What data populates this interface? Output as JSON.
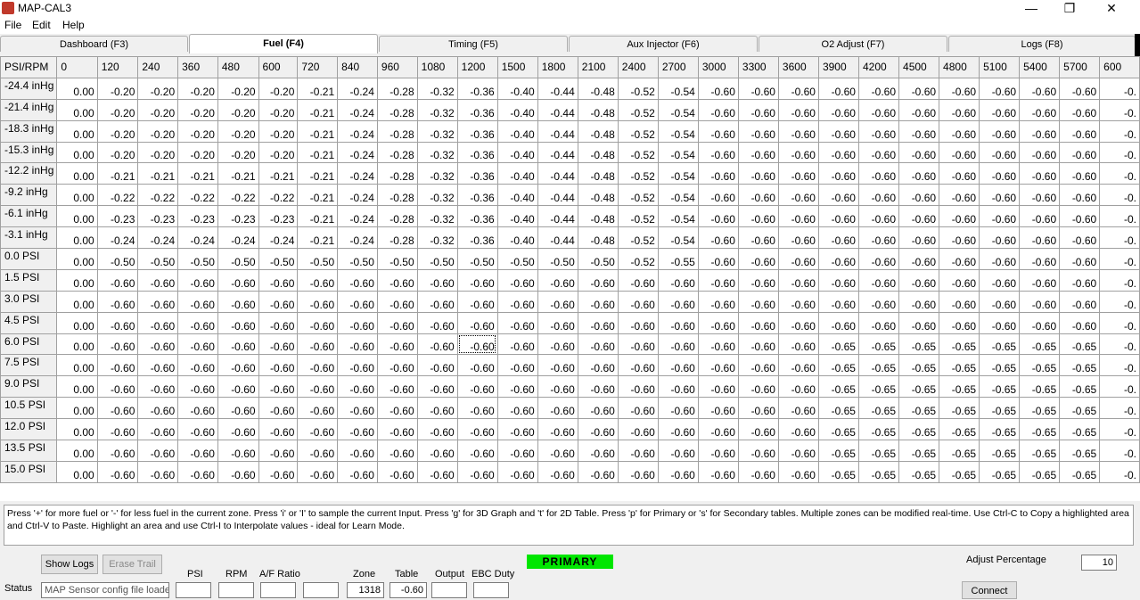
{
  "window": {
    "title": "MAP-CAL3",
    "minimize": "—",
    "restore": "❐",
    "close": "✕"
  },
  "menu": [
    "File",
    "Edit",
    "Help"
  ],
  "tabs": [
    {
      "label": "Dashboard (F3)",
      "active": false
    },
    {
      "label": "Fuel (F4)",
      "active": true
    },
    {
      "label": "Timing (F5)",
      "active": false
    },
    {
      "label": "Aux Injector (F6)",
      "active": false
    },
    {
      "label": "O2 Adjust (F7)",
      "active": false
    },
    {
      "label": "Logs (F8)",
      "active": false
    }
  ],
  "grid": {
    "corner": "PSI/RPM",
    "columns": [
      "0",
      "120",
      "240",
      "360",
      "480",
      "600",
      "720",
      "840",
      "960",
      "1080",
      "1200",
      "1500",
      "1800",
      "2100",
      "2400",
      "2700",
      "3000",
      "3300",
      "3600",
      "3900",
      "4200",
      "4500",
      "4800",
      "5100",
      "5400",
      "5700",
      "600"
    ],
    "selected": {
      "row": 12,
      "col": 10
    },
    "rows": [
      {
        "label": "-24.4 inHg",
        "values": [
          "0.00",
          "-0.20",
          "-0.20",
          "-0.20",
          "-0.20",
          "-0.20",
          "-0.21",
          "-0.24",
          "-0.28",
          "-0.32",
          "-0.36",
          "-0.40",
          "-0.44",
          "-0.48",
          "-0.52",
          "-0.54",
          "-0.60",
          "-0.60",
          "-0.60",
          "-0.60",
          "-0.60",
          "-0.60",
          "-0.60",
          "-0.60",
          "-0.60",
          "-0.60",
          "-0."
        ]
      },
      {
        "label": "-21.4 inHg",
        "values": [
          "0.00",
          "-0.20",
          "-0.20",
          "-0.20",
          "-0.20",
          "-0.20",
          "-0.21",
          "-0.24",
          "-0.28",
          "-0.32",
          "-0.36",
          "-0.40",
          "-0.44",
          "-0.48",
          "-0.52",
          "-0.54",
          "-0.60",
          "-0.60",
          "-0.60",
          "-0.60",
          "-0.60",
          "-0.60",
          "-0.60",
          "-0.60",
          "-0.60",
          "-0.60",
          "-0."
        ]
      },
      {
        "label": "-18.3 inHg",
        "values": [
          "0.00",
          "-0.20",
          "-0.20",
          "-0.20",
          "-0.20",
          "-0.20",
          "-0.21",
          "-0.24",
          "-0.28",
          "-0.32",
          "-0.36",
          "-0.40",
          "-0.44",
          "-0.48",
          "-0.52",
          "-0.54",
          "-0.60",
          "-0.60",
          "-0.60",
          "-0.60",
          "-0.60",
          "-0.60",
          "-0.60",
          "-0.60",
          "-0.60",
          "-0.60",
          "-0."
        ]
      },
      {
        "label": "-15.3 inHg",
        "values": [
          "0.00",
          "-0.20",
          "-0.20",
          "-0.20",
          "-0.20",
          "-0.20",
          "-0.21",
          "-0.24",
          "-0.28",
          "-0.32",
          "-0.36",
          "-0.40",
          "-0.44",
          "-0.48",
          "-0.52",
          "-0.54",
          "-0.60",
          "-0.60",
          "-0.60",
          "-0.60",
          "-0.60",
          "-0.60",
          "-0.60",
          "-0.60",
          "-0.60",
          "-0.60",
          "-0."
        ]
      },
      {
        "label": "-12.2 inHg",
        "values": [
          "0.00",
          "-0.21",
          "-0.21",
          "-0.21",
          "-0.21",
          "-0.21",
          "-0.21",
          "-0.24",
          "-0.28",
          "-0.32",
          "-0.36",
          "-0.40",
          "-0.44",
          "-0.48",
          "-0.52",
          "-0.54",
          "-0.60",
          "-0.60",
          "-0.60",
          "-0.60",
          "-0.60",
          "-0.60",
          "-0.60",
          "-0.60",
          "-0.60",
          "-0.60",
          "-0."
        ]
      },
      {
        "label": "-9.2 inHg",
        "values": [
          "0.00",
          "-0.22",
          "-0.22",
          "-0.22",
          "-0.22",
          "-0.22",
          "-0.21",
          "-0.24",
          "-0.28",
          "-0.32",
          "-0.36",
          "-0.40",
          "-0.44",
          "-0.48",
          "-0.52",
          "-0.54",
          "-0.60",
          "-0.60",
          "-0.60",
          "-0.60",
          "-0.60",
          "-0.60",
          "-0.60",
          "-0.60",
          "-0.60",
          "-0.60",
          "-0."
        ]
      },
      {
        "label": "-6.1 inHg",
        "values": [
          "0.00",
          "-0.23",
          "-0.23",
          "-0.23",
          "-0.23",
          "-0.23",
          "-0.21",
          "-0.24",
          "-0.28",
          "-0.32",
          "-0.36",
          "-0.40",
          "-0.44",
          "-0.48",
          "-0.52",
          "-0.54",
          "-0.60",
          "-0.60",
          "-0.60",
          "-0.60",
          "-0.60",
          "-0.60",
          "-0.60",
          "-0.60",
          "-0.60",
          "-0.60",
          "-0."
        ]
      },
      {
        "label": "-3.1 inHg",
        "values": [
          "0.00",
          "-0.24",
          "-0.24",
          "-0.24",
          "-0.24",
          "-0.24",
          "-0.21",
          "-0.24",
          "-0.28",
          "-0.32",
          "-0.36",
          "-0.40",
          "-0.44",
          "-0.48",
          "-0.52",
          "-0.54",
          "-0.60",
          "-0.60",
          "-0.60",
          "-0.60",
          "-0.60",
          "-0.60",
          "-0.60",
          "-0.60",
          "-0.60",
          "-0.60",
          "-0."
        ]
      },
      {
        "label": "0.0 PSI",
        "values": [
          "0.00",
          "-0.50",
          "-0.50",
          "-0.50",
          "-0.50",
          "-0.50",
          "-0.50",
          "-0.50",
          "-0.50",
          "-0.50",
          "-0.50",
          "-0.50",
          "-0.50",
          "-0.50",
          "-0.52",
          "-0.55",
          "-0.60",
          "-0.60",
          "-0.60",
          "-0.60",
          "-0.60",
          "-0.60",
          "-0.60",
          "-0.60",
          "-0.60",
          "-0.60",
          "-0."
        ]
      },
      {
        "label": "1.5 PSI",
        "values": [
          "0.00",
          "-0.60",
          "-0.60",
          "-0.60",
          "-0.60",
          "-0.60",
          "-0.60",
          "-0.60",
          "-0.60",
          "-0.60",
          "-0.60",
          "-0.60",
          "-0.60",
          "-0.60",
          "-0.60",
          "-0.60",
          "-0.60",
          "-0.60",
          "-0.60",
          "-0.60",
          "-0.60",
          "-0.60",
          "-0.60",
          "-0.60",
          "-0.60",
          "-0.60",
          "-0."
        ]
      },
      {
        "label": "3.0 PSI",
        "values": [
          "0.00",
          "-0.60",
          "-0.60",
          "-0.60",
          "-0.60",
          "-0.60",
          "-0.60",
          "-0.60",
          "-0.60",
          "-0.60",
          "-0.60",
          "-0.60",
          "-0.60",
          "-0.60",
          "-0.60",
          "-0.60",
          "-0.60",
          "-0.60",
          "-0.60",
          "-0.60",
          "-0.60",
          "-0.60",
          "-0.60",
          "-0.60",
          "-0.60",
          "-0.60",
          "-0."
        ]
      },
      {
        "label": "4.5 PSI",
        "values": [
          "0.00",
          "-0.60",
          "-0.60",
          "-0.60",
          "-0.60",
          "-0.60",
          "-0.60",
          "-0.60",
          "-0.60",
          "-0.60",
          "-0.60",
          "-0.60",
          "-0.60",
          "-0.60",
          "-0.60",
          "-0.60",
          "-0.60",
          "-0.60",
          "-0.60",
          "-0.60",
          "-0.60",
          "-0.60",
          "-0.60",
          "-0.60",
          "-0.60",
          "-0.60",
          "-0."
        ]
      },
      {
        "label": "6.0 PSI",
        "values": [
          "0.00",
          "-0.60",
          "-0.60",
          "-0.60",
          "-0.60",
          "-0.60",
          "-0.60",
          "-0.60",
          "-0.60",
          "-0.60",
          "-0.60",
          "-0.60",
          "-0.60",
          "-0.60",
          "-0.60",
          "-0.60",
          "-0.60",
          "-0.60",
          "-0.60",
          "-0.65",
          "-0.65",
          "-0.65",
          "-0.65",
          "-0.65",
          "-0.65",
          "-0.65",
          "-0."
        ]
      },
      {
        "label": "7.5 PSI",
        "values": [
          "0.00",
          "-0.60",
          "-0.60",
          "-0.60",
          "-0.60",
          "-0.60",
          "-0.60",
          "-0.60",
          "-0.60",
          "-0.60",
          "-0.60",
          "-0.60",
          "-0.60",
          "-0.60",
          "-0.60",
          "-0.60",
          "-0.60",
          "-0.60",
          "-0.60",
          "-0.65",
          "-0.65",
          "-0.65",
          "-0.65",
          "-0.65",
          "-0.65",
          "-0.65",
          "-0."
        ]
      },
      {
        "label": "9.0 PSI",
        "values": [
          "0.00",
          "-0.60",
          "-0.60",
          "-0.60",
          "-0.60",
          "-0.60",
          "-0.60",
          "-0.60",
          "-0.60",
          "-0.60",
          "-0.60",
          "-0.60",
          "-0.60",
          "-0.60",
          "-0.60",
          "-0.60",
          "-0.60",
          "-0.60",
          "-0.60",
          "-0.65",
          "-0.65",
          "-0.65",
          "-0.65",
          "-0.65",
          "-0.65",
          "-0.65",
          "-0."
        ]
      },
      {
        "label": "10.5 PSI",
        "values": [
          "0.00",
          "-0.60",
          "-0.60",
          "-0.60",
          "-0.60",
          "-0.60",
          "-0.60",
          "-0.60",
          "-0.60",
          "-0.60",
          "-0.60",
          "-0.60",
          "-0.60",
          "-0.60",
          "-0.60",
          "-0.60",
          "-0.60",
          "-0.60",
          "-0.60",
          "-0.65",
          "-0.65",
          "-0.65",
          "-0.65",
          "-0.65",
          "-0.65",
          "-0.65",
          "-0."
        ]
      },
      {
        "label": "12.0 PSI",
        "values": [
          "0.00",
          "-0.60",
          "-0.60",
          "-0.60",
          "-0.60",
          "-0.60",
          "-0.60",
          "-0.60",
          "-0.60",
          "-0.60",
          "-0.60",
          "-0.60",
          "-0.60",
          "-0.60",
          "-0.60",
          "-0.60",
          "-0.60",
          "-0.60",
          "-0.60",
          "-0.65",
          "-0.65",
          "-0.65",
          "-0.65",
          "-0.65",
          "-0.65",
          "-0.65",
          "-0."
        ]
      },
      {
        "label": "13.5 PSI",
        "values": [
          "0.00",
          "-0.60",
          "-0.60",
          "-0.60",
          "-0.60",
          "-0.60",
          "-0.60",
          "-0.60",
          "-0.60",
          "-0.60",
          "-0.60",
          "-0.60",
          "-0.60",
          "-0.60",
          "-0.60",
          "-0.60",
          "-0.60",
          "-0.60",
          "-0.60",
          "-0.65",
          "-0.65",
          "-0.65",
          "-0.65",
          "-0.65",
          "-0.65",
          "-0.65",
          "-0."
        ]
      },
      {
        "label": "15.0 PSI",
        "values": [
          "0.00",
          "-0.60",
          "-0.60",
          "-0.60",
          "-0.60",
          "-0.60",
          "-0.60",
          "-0.60",
          "-0.60",
          "-0.60",
          "-0.60",
          "-0.60",
          "-0.60",
          "-0.60",
          "-0.60",
          "-0.60",
          "-0.60",
          "-0.60",
          "-0.60",
          "-0.65",
          "-0.65",
          "-0.65",
          "-0.65",
          "-0.65",
          "-0.65",
          "-0.65",
          "-0."
        ]
      }
    ]
  },
  "help_text": "Press '+' for more fuel or '-' for less fuel in the current zone.  Press 'i' or 'I' to sample the current Input.  Press 'g' for 3D Graph and 't' for 2D Table.  Press 'p' for Primary or 's' for Secondary tables. Multiple zones can be modified real-time.  Use Ctrl-C to Copy a highlighted area and Ctrl-V to Paste.  Highlight an area and use Ctrl-I to Interpolate values - ideal for Learn Mode.",
  "bottom": {
    "show_logs": "Show Logs",
    "erase_trail": "Erase Trail",
    "status_label": "Status",
    "status_value": "MAP Sensor config file loade",
    "psi_label": "PSI",
    "psi_value": "",
    "rpm_label": "RPM",
    "rpm_value": "",
    "afr_label": "A/F Ratio",
    "afr_value": "",
    "extra_value": "",
    "zone_label": "Zone",
    "zone_value": "1318",
    "table_label": "Table",
    "table_value": "-0.60",
    "output_label": "Output",
    "output_value": "",
    "ebc_label": "EBC Duty",
    "ebc_value": "",
    "mode": "PRIMARY",
    "adjust_label": "Adjust Percentage",
    "adjust_value": "10",
    "connect": "Connect"
  },
  "colors": {
    "primary_indicator": "#00e600",
    "accent_icon": "#c0392b"
  }
}
